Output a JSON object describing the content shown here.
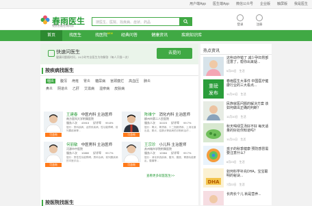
{
  "top_links": [
    "用户端App",
    "医生端App",
    "微信公众号",
    "企业版",
    "触屏版",
    "我是医生"
  ],
  "brand": {
    "name": "春雨医生",
    "slogan": "免费名医在线问诊",
    "color": "#40a944"
  },
  "search": {
    "placeholder": "搜医生、医院、找疾病、症状、药品"
  },
  "header_links": [
    {
      "label": "登录",
      "icon": "user-icon"
    },
    {
      "label": "注册",
      "icon": "register-icon"
    }
  ],
  "nav": [
    {
      "label": "首页",
      "active": true,
      "badge": ""
    },
    {
      "label": "找医生",
      "active": false,
      "badge": ""
    },
    {
      "label": "找医院",
      "active": false,
      "badge": "NEW"
    },
    {
      "label": "经典问答",
      "active": false,
      "badge": ""
    },
    {
      "label": "健康资讯",
      "active": false,
      "badge": ""
    },
    {
      "label": "疾病知识库",
      "active": false,
      "badge": ""
    }
  ],
  "ask": {
    "title": "快速问医生",
    "subtitle": "健康问题随时问，24小时专业医生为你解答（每人只限一次）",
    "button": "去提问"
  },
  "doctors_section": {
    "title": "按疾病找医生",
    "more": "查看更多就医医生>>"
  },
  "tags_row1": [
    "咽炎",
    "腹泻",
    "痔疮",
    "胃炎",
    "糖尿病",
    "宫颈糜烂",
    "高血压",
    "肺炎"
  ],
  "tags_row2": [
    "鼻炎",
    "阴道炎",
    "乙肝",
    "艾滋病",
    "湿疹病",
    "皮肤病"
  ],
  "doctors": [
    {
      "name": "王建春",
      "title": "中医内科 主治医师",
      "hospital": "南方医科大学附属医院",
      "service_label": "服务人次",
      "service": "43915",
      "rating_label": "好评率",
      "rating": "99.8%",
      "desc": "擅长：男科疾病、泌尿系疾病、性功能障碍、前列腺疾病等...",
      "badge": "可咨询"
    },
    {
      "name": "陈维宁",
      "title": "消化内科 主治医师",
      "hospital": "柳州市第二人民医院",
      "service_label": "服务人次",
      "service": "32223",
      "rating_label": "好评率",
      "rating": "99.7%",
      "desc": "擅长：胃炎、胃溃疡、十二指肠溃疡、上消化道出血、肠炎、结肠炎等疾病的诊断和治疗...",
      "badge": "可咨询"
    },
    {
      "name": "何丽敏",
      "title": "中医男科 主治医师",
      "hospital": "河源市中医院",
      "service_label": "服务人次",
      "service": "10880",
      "rating_label": "好评率",
      "rating": "99.7%",
      "desc": "擅长：男性性功能障碍、男科杂病、前列腺疾病的中医诊治...",
      "badge": "可咨询"
    },
    {
      "name": "王宗珍",
      "title": "小儿科 主治医师",
      "hospital": "苏州城市学院附属医院",
      "service_label": "服务人次",
      "service": "10384",
      "rating_label": "好评率",
      "rating": "99.7%",
      "desc": "擅长：消化系统疾病、腹泻、腹胀、胃肠功能紊乱、腹痛等...",
      "badge": "可咨询"
    }
  ],
  "section2_title": "按医院找医生",
  "side": {
    "title": "热点资讯"
  },
  "news": [
    {
      "title": "这些动作错了 减少孕妇胃部注意了，帮你出来疑...",
      "date": "5月20日",
      "tag": "生活"
    },
    {
      "title": "春雨医生大事件 中国医疗健康行业的三大看点...",
      "date": "11月10日",
      "tag": "生活"
    },
    {
      "title": "民族就医问题的解决方案 该如何做出正确的判断？",
      "date": "11月10日",
      "tag": "生活"
    },
    {
      "title": "秋天喝绿豆汤好不好 每天适量的好处你知道吗？",
      "date": "11月11日",
      "tag": "生活"
    },
    {
      "title": "孩子的秋季健康 预防感冒需要注意什么？",
      "date": "8月23日",
      "tag": "生活"
    },
    {
      "title": "如何科学补充DHA，宝宝聪明的秘诀...",
      "date": "7月22日",
      "tag": "生活"
    },
    {
      "title": "长肉长个儿 就是营养...",
      "date": "",
      "tag": ""
    }
  ]
}
